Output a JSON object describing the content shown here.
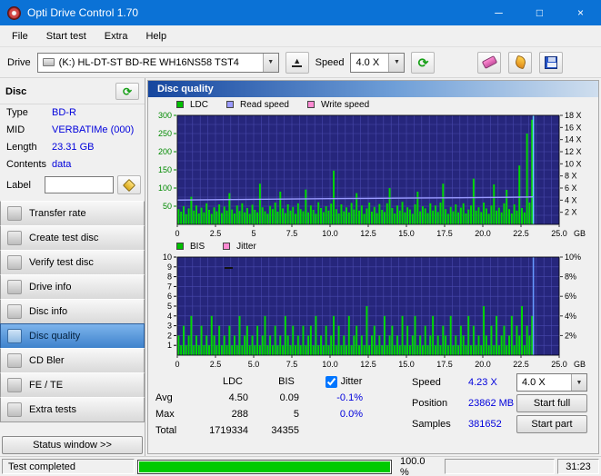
{
  "window": {
    "title": "Opti Drive Control 1.70"
  },
  "icons": {
    "minimize": "─",
    "maximize": "□",
    "close": "×",
    "chevron_down": "▼",
    "eject": "▲",
    "refresh": "⟳"
  },
  "menu": {
    "items": [
      "File",
      "Start test",
      "Extra",
      "Help"
    ]
  },
  "toolbar": {
    "drive_label": "Drive",
    "drive_value": "(K:)  HL-DT-ST BD-RE  WH16NS58 TST4",
    "speed_label": "Speed",
    "speed_value": "4.0 X"
  },
  "disc_panel": {
    "title": "Disc",
    "fields": [
      {
        "label": "Type",
        "value": "BD-R"
      },
      {
        "label": "MID",
        "value": "VERBATIMe (000)"
      },
      {
        "label": "Length",
        "value": "23.31 GB"
      },
      {
        "label": "Contents",
        "value": "data"
      }
    ],
    "label_field": {
      "label": "Label",
      "value": ""
    },
    "buttons": [
      "Transfer rate",
      "Create test disc",
      "Verify test disc",
      "Drive info",
      "Disc info",
      "Disc quality",
      "CD Bler",
      "FE / TE",
      "Extra tests"
    ],
    "active_button": "Disc quality",
    "status_window": "Status window >>"
  },
  "main": {
    "title": "Disc quality",
    "legend_top": [
      {
        "label": "LDC",
        "color": "#00c000"
      },
      {
        "label": "Read speed",
        "color": "#9a9aff"
      },
      {
        "label": "Write speed",
        "color": "#ff8ad2"
      }
    ],
    "legend_bottom": [
      {
        "label": "BIS",
        "color": "#00c000"
      },
      {
        "label": "Jitter",
        "color": "#ff8ad2"
      }
    ],
    "stats": {
      "col_headers": [
        "LDC",
        "BIS",
        "Jitter"
      ],
      "jitter_checked": true,
      "rows": [
        {
          "label": "Avg",
          "ldc": "4.50",
          "bis": "0.09",
          "jitter": "-0.1%"
        },
        {
          "label": "Max",
          "ldc": "288",
          "bis": "5",
          "jitter": "0.0%"
        },
        {
          "label": "Total",
          "ldc": "1719334",
          "bis": "34355",
          "jitter": ""
        }
      ],
      "speed_label": "Speed",
      "speed_value": "4.23 X",
      "speed_select": "4.0 X",
      "position_label": "Position",
      "position_value": "23862 MB",
      "samples_label": "Samples",
      "samples_value": "381652",
      "start_full": "Start full",
      "start_part": "Start part"
    }
  },
  "status_bar": {
    "status": "Test completed",
    "progress": "100.0 %",
    "progress_pct": 100,
    "time": "31:23"
  },
  "chart_data": [
    {
      "type": "bar",
      "name": "ldc-read-speed",
      "bg": "#26267c",
      "grid_color": "#4a4aae",
      "bar_color": "#00d800",
      "x": {
        "max_gb": 25.0,
        "data_end_gb": 23.31,
        "grid_step_gb": 0.5,
        "unit": "GB",
        "ticks": [
          [
            0,
            "0"
          ],
          [
            2.5,
            "2.5"
          ],
          [
            5,
            "5"
          ],
          [
            7.5,
            "7.5"
          ],
          [
            10,
            "10.0"
          ],
          [
            12.5,
            "12.5"
          ],
          [
            15,
            "15.0"
          ],
          [
            17.5,
            "17.5"
          ],
          [
            20,
            "20.0"
          ],
          [
            22.5,
            "22.5"
          ],
          [
            25,
            "25.0"
          ]
        ]
      },
      "y_left": {
        "max": 300,
        "grid_step": 25,
        "tick_color": "#008a00",
        "ticks": [
          [
            300,
            "300"
          ],
          [
            250,
            "250"
          ],
          [
            200,
            "200"
          ],
          [
            150,
            "150"
          ],
          [
            100,
            "100"
          ],
          [
            50,
            "50"
          ]
        ]
      },
      "y_right": {
        "max": 18,
        "ticks": [
          [
            18,
            "18 X"
          ],
          [
            16,
            "16 X"
          ],
          [
            14,
            "14 X"
          ],
          [
            12,
            "12 X"
          ],
          [
            10,
            "10 X"
          ],
          [
            8,
            "8 X"
          ],
          [
            6,
            "6 X"
          ],
          [
            4,
            "4 X"
          ],
          [
            2,
            "2 X"
          ]
        ]
      },
      "bars": [
        42,
        35,
        50,
        28,
        44,
        76,
        38,
        52,
        30,
        46,
        33,
        58,
        40,
        29,
        47,
        36,
        55,
        31,
        49,
        38,
        86,
        41,
        30,
        52,
        37,
        58,
        33,
        45,
        29,
        54,
        40,
        33,
        112,
        47,
        36,
        29,
        51,
        42,
        60,
        35,
        90,
        44,
        31,
        55,
        38,
        48,
        29,
        58,
        42,
        36,
        96,
        33,
        52,
        40,
        29,
        61,
        45,
        34,
        50,
        38,
        57,
        148,
        42,
        30,
        55,
        36,
        47,
        33,
        59,
        41,
        86,
        38,
        52,
        29,
        44,
        60,
        35,
        48,
        31,
        56,
        40,
        34,
        58,
        100,
        45,
        30,
        52,
        38,
        62,
        33,
        47,
        41,
        29,
        55,
        90,
        36,
        50,
        44,
        31,
        58,
        38,
        52,
        34,
        60,
        112,
        42,
        29,
        48,
        36,
        55,
        33,
        46,
        58,
        30,
        41,
        52,
        126,
        38,
        47,
        34,
        60,
        44,
        29,
        52,
        110,
        38,
        46,
        33,
        58,
        95,
        42,
        30,
        55,
        38,
        162,
        45,
        33,
        250,
        60,
        288
      ],
      "line": {
        "name": "read-speed",
        "color": "#9a9aff",
        "axis": "right",
        "points": [
          [
            0,
            4.02
          ],
          [
            2.5,
            4.08
          ],
          [
            5,
            4.14
          ],
          [
            7.5,
            4.19
          ],
          [
            10,
            4.24
          ],
          [
            12.5,
            4.29
          ],
          [
            15,
            4.34
          ],
          [
            17.5,
            4.38
          ],
          [
            20,
            4.43
          ],
          [
            22,
            4.48
          ],
          [
            23,
            4.52
          ],
          [
            23.31,
            4.55
          ]
        ]
      },
      "end_marker": {
        "gb": 23.31,
        "color": "#66ccff"
      }
    },
    {
      "type": "bar",
      "name": "bis-jitter",
      "bg": "#26267c",
      "grid_color": "#4a4aae",
      "bar_color": "#00d800",
      "x": {
        "max_gb": 25.0,
        "data_end_gb": 23.31,
        "grid_step_gb": 0.5,
        "unit": "GB",
        "ticks": [
          [
            0,
            "0"
          ],
          [
            2.5,
            "2.5"
          ],
          [
            5,
            "5.0"
          ],
          [
            7.5,
            "7.5"
          ],
          [
            10,
            "10.0"
          ],
          [
            12.5,
            "12.5"
          ],
          [
            15,
            "15.0"
          ],
          [
            17.5,
            "17.5"
          ],
          [
            20,
            "20.0"
          ],
          [
            22.5,
            "22.5"
          ],
          [
            25,
            "25.0"
          ]
        ]
      },
      "y_left": {
        "max": 10,
        "grid_step": 1,
        "tick_color": "#000000",
        "ticks": [
          [
            10,
            "10"
          ],
          [
            9,
            "9"
          ],
          [
            8,
            "8"
          ],
          [
            7,
            "7"
          ],
          [
            6,
            "6"
          ],
          [
            5,
            "5"
          ],
          [
            4,
            "4"
          ],
          [
            3,
            "3"
          ],
          [
            2,
            "2"
          ],
          [
            1,
            "1"
          ]
        ]
      },
      "y_right": {
        "max": 10,
        "ticks": [
          [
            10,
            "10%"
          ],
          [
            8,
            "8%"
          ],
          [
            6,
            "6%"
          ],
          [
            4,
            "4%"
          ],
          [
            2,
            "2%"
          ]
        ]
      },
      "bars": [
        2,
        1,
        3,
        1,
        2,
        4,
        1,
        2,
        1,
        3,
        1,
        2,
        1,
        4,
        2,
        1,
        3,
        1,
        2,
        1,
        3,
        1,
        2,
        1,
        4,
        1,
        2,
        3,
        1,
        2,
        1,
        3,
        1,
        2,
        4,
        1,
        2,
        1,
        3,
        1,
        2,
        1,
        4,
        2,
        1,
        3,
        1,
        2,
        1,
        3,
        1,
        2,
        3,
        1,
        4,
        1,
        2,
        1,
        3,
        1,
        2,
        4,
        1,
        3,
        1,
        2,
        1,
        4,
        1,
        2,
        3,
        1,
        2,
        1,
        5,
        1,
        2,
        3,
        1,
        2,
        1,
        4,
        1,
        2,
        3,
        1,
        2,
        1,
        4,
        1,
        3,
        1,
        2,
        4,
        1,
        2,
        1,
        3,
        1,
        2,
        4,
        1,
        2,
        1,
        3,
        2,
        1,
        4,
        1,
        2,
        1,
        3,
        2,
        1,
        4,
        1,
        3,
        1,
        2,
        1,
        5,
        2,
        1,
        3,
        1,
        4,
        1,
        2,
        3,
        1,
        2,
        4,
        1,
        3,
        2,
        5,
        1,
        3,
        2,
        4
      ],
      "end_marker": {
        "gb": 23.31,
        "color": "#6699ff"
      }
    }
  ]
}
